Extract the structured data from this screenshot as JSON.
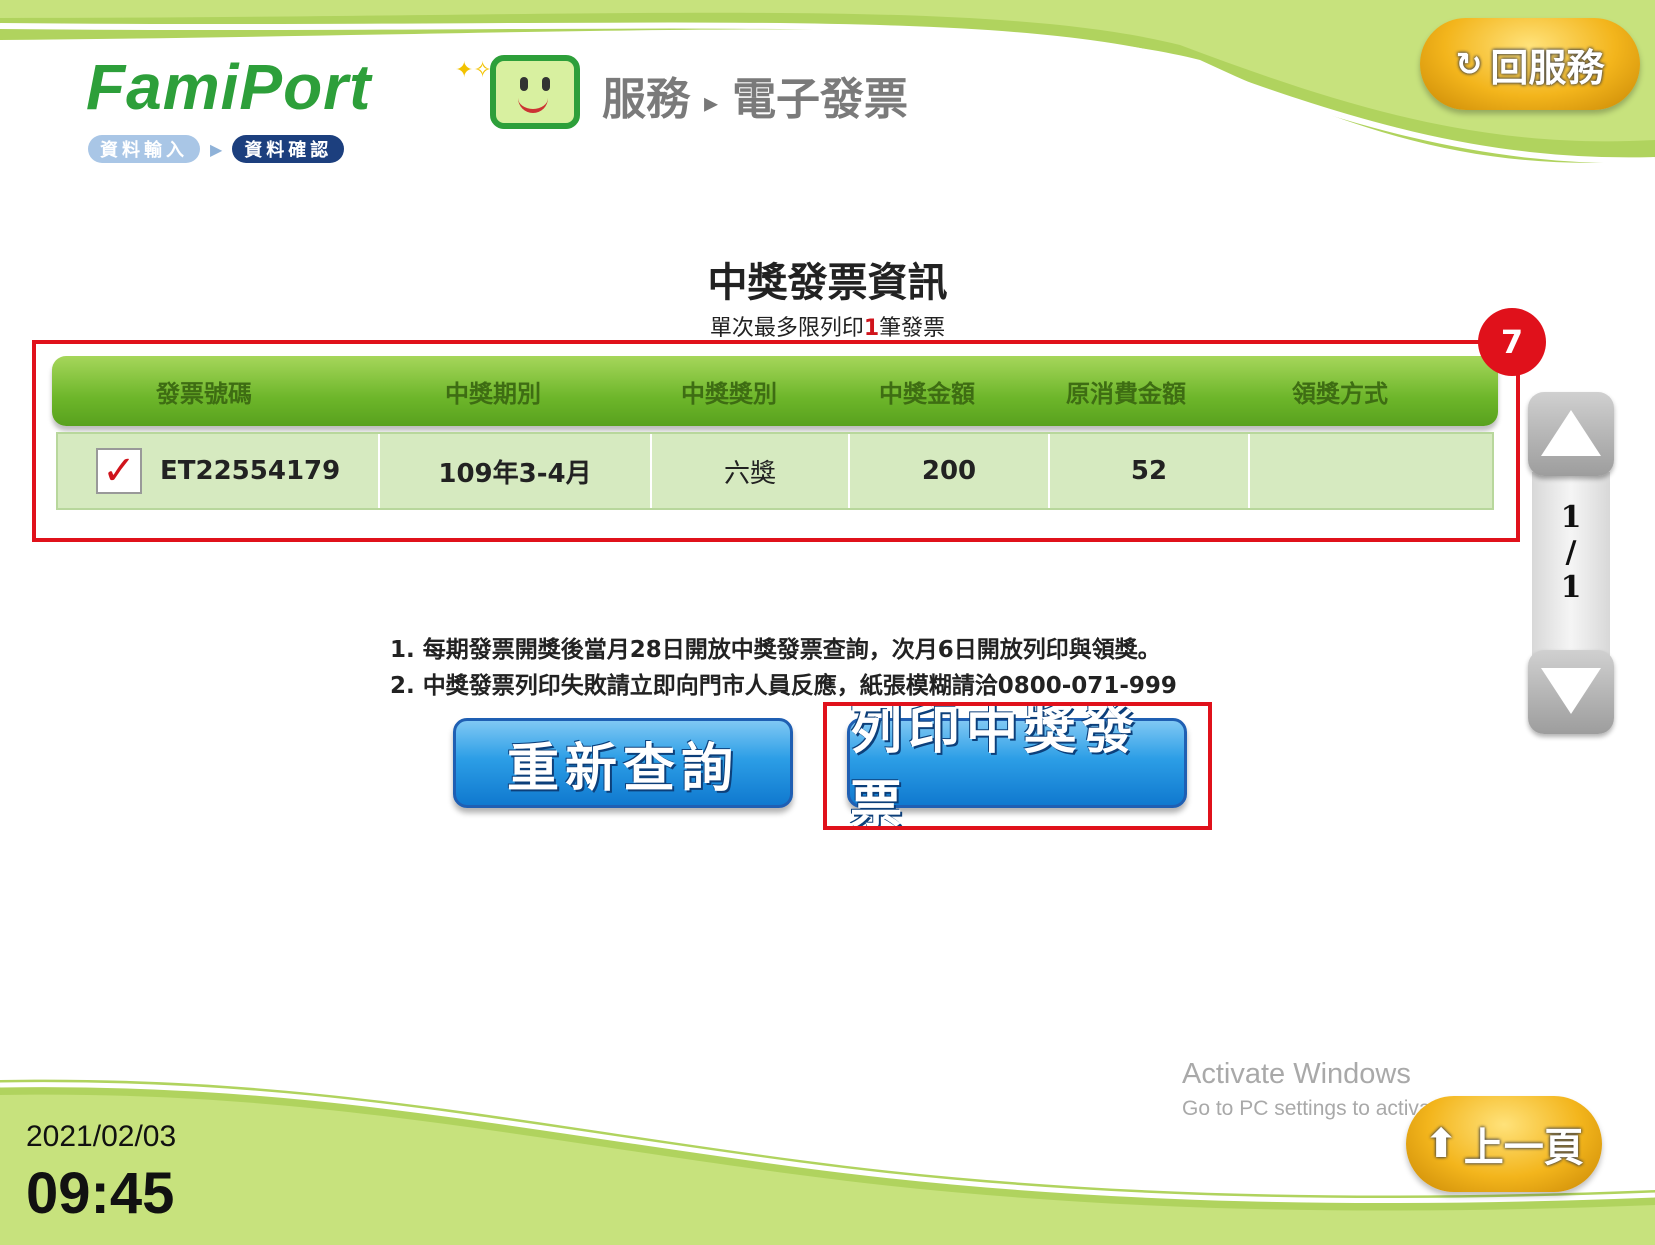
{
  "header": {
    "logo_text": "FamiPort",
    "breadcrumb": {
      "service": "服務",
      "arrow": "▸",
      "page": "電子發票"
    },
    "steps": [
      "資料輸入",
      "資料確認"
    ],
    "back_button": {
      "icon": "refresh-icon",
      "label": "回服務"
    }
  },
  "panel": {
    "title": "中獎發票資訊",
    "subtitle_prefix": "單次最多限列印",
    "subtitle_limit": "1",
    "subtitle_suffix": "筆發票",
    "badge": "7"
  },
  "table": {
    "columns": [
      "發票號碼",
      "中獎期別",
      "中獎獎別",
      "中獎金額",
      "原消費金額",
      "領獎方式"
    ],
    "rows": [
      {
        "checked": true,
        "check_mark": "✓",
        "invoice_no": "ET22554179",
        "period": "109年3-4月",
        "prize": "六獎",
        "amount": "200",
        "original_amount": "52",
        "method": ""
      }
    ]
  },
  "pager": {
    "current": "1",
    "sep": "/",
    "total": "1"
  },
  "notes": [
    "1. 每期發票開獎後當月28日開放中獎發票查詢，次月6日開放列印與領獎。",
    "2. 中獎發票列印失敗請立即向門市人員反應，紙張模糊請洽0800-071-999"
  ],
  "buttons": {
    "requery": "重新查詢",
    "print": "列印中獎發票"
  },
  "watermark": {
    "line1": "Activate Windows",
    "line2": "Go to PC settings to activate Windows."
  },
  "footer": {
    "date": "2021/02/03",
    "time": "09:45",
    "prev_button": {
      "icon": "up-arrow-icon",
      "label": "上一頁"
    }
  },
  "colors": {
    "brand_green": "#2d9f3a",
    "highlight_red": "#e0111b",
    "button_blue": "#1079cf",
    "gold": "#f3b51c"
  }
}
